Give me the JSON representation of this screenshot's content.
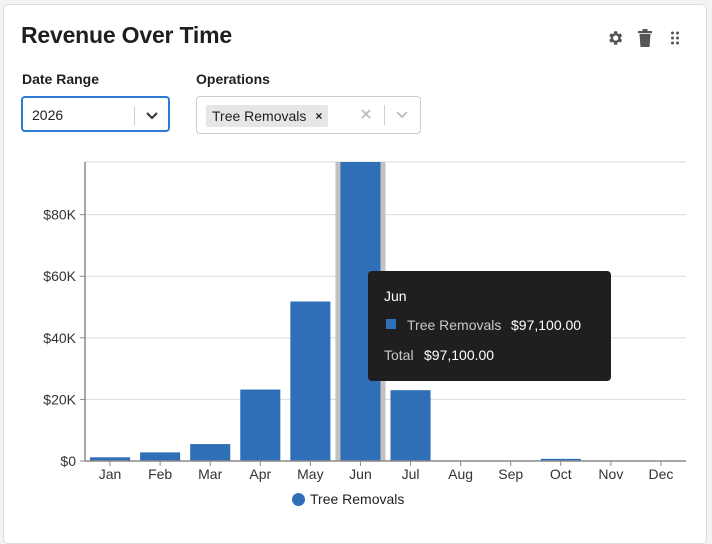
{
  "widget": {
    "title": "Revenue Over Time",
    "tools": [
      "gear-icon",
      "trash-icon",
      "drag-handle-icon"
    ]
  },
  "filters": {
    "date_range": {
      "label": "Date Range",
      "value": "2026"
    },
    "operations": {
      "label": "Operations",
      "selected": [
        "Tree Removals"
      ]
    }
  },
  "tooltip": {
    "title": "Jun",
    "series": "Tree Removals",
    "value": "$97,100.00",
    "total_label": "Total",
    "total_value": "$97,100.00"
  },
  "colors": {
    "bar": "#2e6fb7",
    "highlight": "#c2c2c2",
    "grid": "#d9d9d9",
    "axis": "#8a8a8a",
    "focus": "#2f7bd9"
  },
  "chart_data": {
    "type": "bar",
    "categories": [
      "Jan",
      "Feb",
      "Mar",
      "Apr",
      "May",
      "Jun",
      "Jul",
      "Aug",
      "Sep",
      "Oct",
      "Nov",
      "Dec"
    ],
    "series": [
      {
        "name": "Tree Removals",
        "values": [
          1200,
          2800,
          5500,
          23200,
          51800,
          97100,
          23000,
          0,
          0,
          700,
          0,
          0
        ]
      }
    ],
    "ylim": [
      0,
      97100
    ],
    "yticks": [
      0,
      20000,
      40000,
      60000,
      80000
    ],
    "ytick_labels": [
      "$0",
      "$20K",
      "$40K",
      "$60K",
      "$80K"
    ],
    "highlighted_category": "Jun",
    "grid": true,
    "legend": "bottom-center"
  }
}
